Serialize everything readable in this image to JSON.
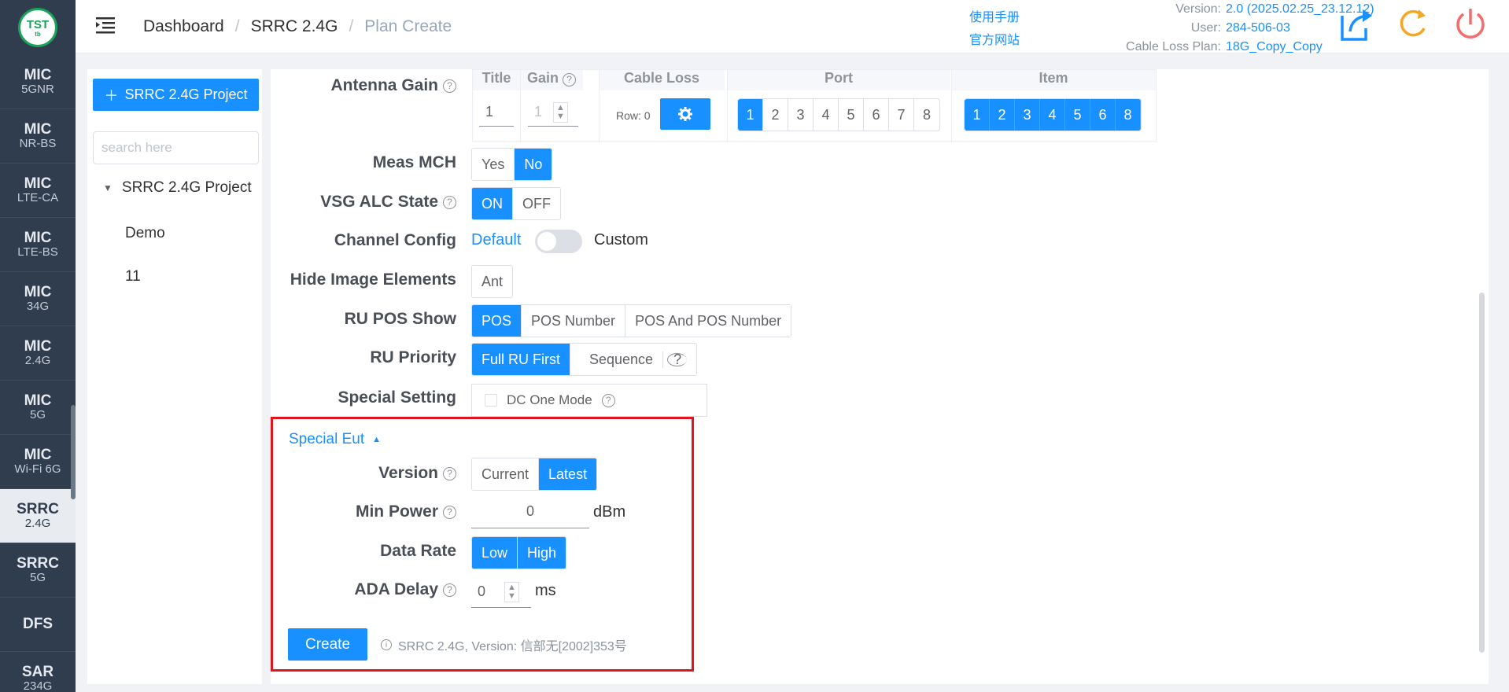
{
  "logo": {
    "main": "TST",
    "sub": "tb"
  },
  "nav": [
    {
      "t1": "MIC",
      "t2": "5GNR"
    },
    {
      "t1": "MIC",
      "t2": "NR-BS"
    },
    {
      "t1": "MIC",
      "t2": "LTE-CA"
    },
    {
      "t1": "MIC",
      "t2": "LTE-BS"
    },
    {
      "t1": "MIC",
      "t2": "34G"
    },
    {
      "t1": "MIC",
      "t2": "2.4G"
    },
    {
      "t1": "MIC",
      "t2": "5G"
    },
    {
      "t1": "MIC",
      "t2": "Wi-Fi 6G"
    },
    {
      "t1": "SRRC",
      "t2": "2.4G"
    },
    {
      "t1": "SRRC",
      "t2": "5G"
    },
    {
      "t1": "DFS",
      "t2": ""
    },
    {
      "t1": "SAR",
      "t2": "234G"
    }
  ],
  "header": {
    "breadcrumb": [
      "Dashboard",
      "SRRC 2.4G",
      "Plan Create"
    ],
    "links": [
      "使用手册",
      "官方网站"
    ],
    "version_label": "Version:",
    "version_value": "2.0 (2025.02.25_23.12.12)",
    "user_label": "User:",
    "user_value": "284-506-03",
    "cable_label": "Cable Loss Plan:",
    "cable_value": "18G_Copy_Copy"
  },
  "project": {
    "add_button": "SRRC 2.4G Project",
    "search_placeholder": "search here",
    "root": "SRRC 2.4G Project",
    "children": [
      "Demo",
      "11"
    ]
  },
  "form": {
    "antenna_gain_label": "Antenna Gain",
    "table_headers": {
      "title": "Title",
      "gain": "Gain",
      "cable_loss": "Cable Loss",
      "port": "Port",
      "item": "Item"
    },
    "title_value": "1",
    "gain_value": "1",
    "cable_row": "Row: 0",
    "ports": [
      "1",
      "2",
      "3",
      "4",
      "5",
      "6",
      "7",
      "8"
    ],
    "items": [
      "1",
      "2",
      "3",
      "4",
      "5",
      "6",
      "8"
    ],
    "meas_mch_label": "Meas MCH",
    "meas_mch": [
      "Yes",
      "No"
    ],
    "vsg_alc_label": "VSG ALC State",
    "vsg_alc": [
      "ON",
      "OFF"
    ],
    "channel_config_label": "Channel Config",
    "channel_default": "Default",
    "channel_custom": "Custom",
    "hide_image_label": "Hide Image Elements",
    "hide_image": [
      "Ant"
    ],
    "ru_pos_label": "RU POS Show",
    "ru_pos": [
      "POS",
      "POS Number",
      "POS And POS Number"
    ],
    "ru_priority_label": "RU Priority",
    "ru_priority": [
      "Full RU First",
      "Sequence"
    ],
    "special_setting_label": "Special Setting",
    "dc_one_mode": "DC One Mode",
    "special_eut": "Special Eut",
    "version_label": "Version",
    "version": [
      "Current",
      "Latest"
    ],
    "min_power_label": "Min Power",
    "min_power_value": "0",
    "min_power_unit": "dBm",
    "data_rate_label": "Data Rate",
    "data_rate": [
      "Low",
      "High"
    ],
    "ada_delay_label": "ADA Delay",
    "ada_delay_value": "0",
    "ada_delay_unit": "ms",
    "create_button": "Create",
    "note": "SRRC 2.4G, Version: 信部无[2002]353号"
  }
}
